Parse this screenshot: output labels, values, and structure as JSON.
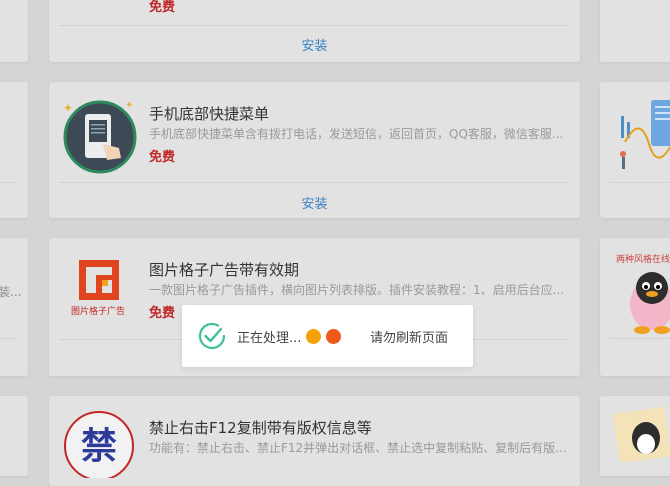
{
  "cards": [
    {
      "price": "免费",
      "install_label": "安装"
    },
    {
      "title": "手机底部快捷菜单",
      "description": "手机底部快捷菜单含有拨打电话，发送短信，返回首页，QQ客服，微信客服...",
      "price": "免费",
      "install_label": "安装"
    },
    {
      "title": "图片格子广告带有效期",
      "description": "一款图片格子广告插件，横向图片列表排版。插件安装教程：1、启用后台应...",
      "price": "免费",
      "logo_text": "图片格子广告"
    },
    {
      "title": "禁止右击F12复制带有版权信息等",
      "description": "功能有：禁止右击、禁止F12并弹出对话框、禁止选中复制粘贴、复制后有版..."
    }
  ],
  "left_column": {
    "snippet": "装..."
  },
  "right_column": {
    "banner_text": "两种风格在线"
  },
  "loading_dialog": {
    "message": "正在处理...",
    "note": "请勿刷新页面",
    "dot_colors": [
      "#f5a20a",
      "#ee5a1c"
    ]
  },
  "colors": {
    "background": "#d5d5d5",
    "card": "#e2e2e2",
    "link": "#3b82c4",
    "price": "#c0282a",
    "check": "#3cbf9b"
  }
}
